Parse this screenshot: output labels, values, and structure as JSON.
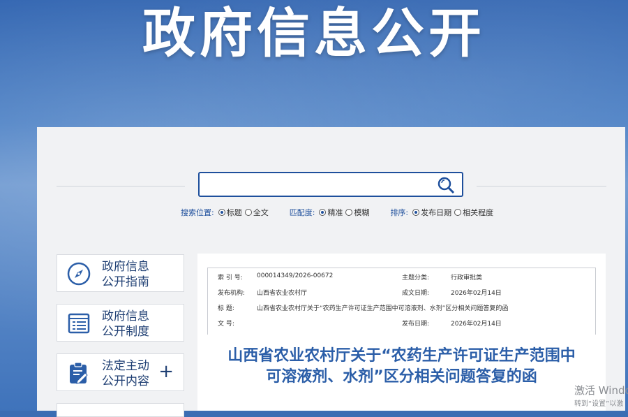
{
  "banner": {
    "title": "政府信息公开"
  },
  "search": {
    "input_value": "",
    "groups": [
      {
        "label": "搜索位置:",
        "options": [
          {
            "label": "标题",
            "checked": true
          },
          {
            "label": "全文",
            "checked": false
          }
        ]
      },
      {
        "label": "匹配度:",
        "options": [
          {
            "label": "精准",
            "checked": true
          },
          {
            "label": "模糊",
            "checked": false
          }
        ]
      },
      {
        "label": "排序:",
        "options": [
          {
            "label": "发布日期",
            "checked": true
          },
          {
            "label": "相关程度",
            "checked": false
          }
        ]
      }
    ]
  },
  "sidebar": {
    "items": [
      {
        "line1": "政府信息",
        "line2": "公开指南",
        "icon": "compass-icon"
      },
      {
        "line1": "政府信息",
        "line2": "公开制度",
        "icon": "list-icon"
      },
      {
        "line1": "法定主动",
        "line2": "公开内容",
        "icon": "document-edit-icon",
        "expand": "+"
      }
    ]
  },
  "document": {
    "meta": [
      {
        "k": "索 引 号:",
        "v": "000014349/2026-00672",
        "k2": "主题分类:",
        "v2": "行政审批类"
      },
      {
        "k": "发布机构:",
        "v": "山西省农业农村厅",
        "k2": "成文日期:",
        "v2": "2026年02月14日"
      },
      {
        "k": "标    题:",
        "v": "山西省农业农村厅关于“农药生产许可证生产范围中可溶液剂、水剂”区分相关问题答复的函",
        "k2": "",
        "v2": ""
      },
      {
        "k": "文    号:",
        "v": "",
        "k2": "发布日期:",
        "v2": "2026年02月14日"
      }
    ],
    "title_line1": "山西省农业农村厅关于“农药生产许可证生产范围中",
    "title_line2": "可溶液剂、水剂”区分相关问题答复的函"
  },
  "watermark": {
    "line1": "激活 Windo",
    "line2": "转到“设置”以激"
  }
}
